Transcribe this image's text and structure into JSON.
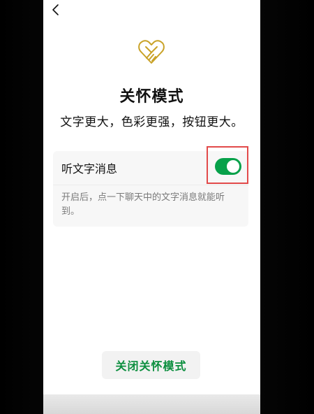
{
  "header": {
    "back_icon": "chevron-left-icon"
  },
  "care_mode": {
    "icon": "heart-hands-icon",
    "icon_color": "#C9A227",
    "title": "关怀模式",
    "subtitle": "文字更大，色彩更强，按钮更大。"
  },
  "setting": {
    "label": "听文字消息",
    "enabled": true,
    "description": "开启后，点一下聊天中的文字消息就能听到。",
    "toggle_color": "#07A14A"
  },
  "footer": {
    "close_button_label": "关闭关怀模式",
    "button_text_color": "#0B8E3E"
  },
  "annotation": {
    "highlight_color": "#E24A4A"
  }
}
